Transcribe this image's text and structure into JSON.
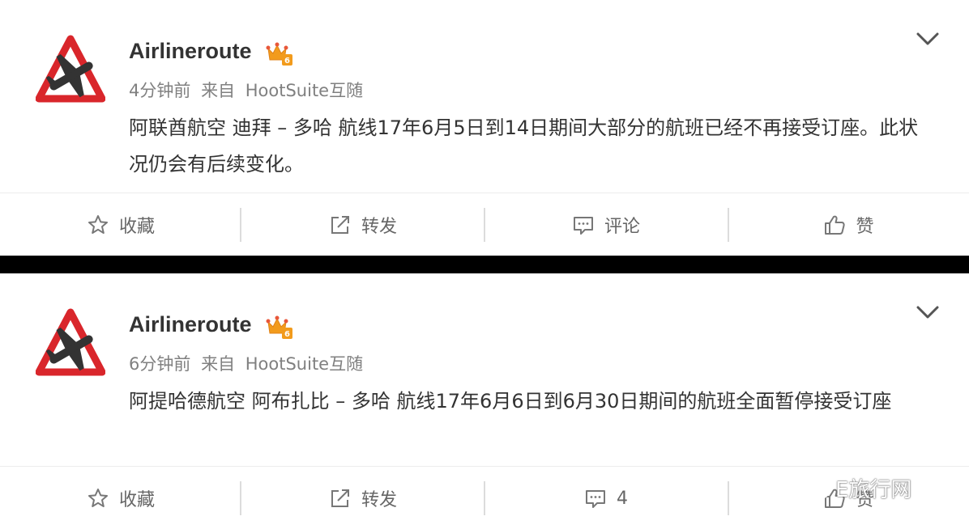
{
  "posts": [
    {
      "username": "Airlineroute",
      "time": "4分钟前",
      "source_prefix": "来自",
      "source": "HootSuite互随",
      "text": "阿联酋航空 迪拜 – 多哈 航线17年6月5日到14日期间大部分的航班已经不再接受订座。此状况仍会有后续变化。",
      "actions": {
        "favorite": "收藏",
        "repost": "转发",
        "comment": "评论",
        "like": "赞"
      }
    },
    {
      "username": "Airlineroute",
      "time": "6分钟前",
      "source_prefix": "来自",
      "source": "HootSuite互随",
      "text": "阿提哈德航空 阿布扎比 – 多哈 航线17年6月6日到6月30日期间的航班全面暂停接受订座",
      "actions": {
        "favorite": "收藏",
        "repost": "转发",
        "comment": "4",
        "like": "赞"
      }
    }
  ],
  "watermark": {
    "text": "E旅行网",
    "icon": "wechat-icon"
  },
  "colors": {
    "avatar_red": "#d9262b",
    "text_primary": "#333333",
    "text_meta": "#808080",
    "crown_orange": "#f29b1c"
  },
  "icons": {
    "favorite": "star-icon",
    "repost": "share-icon",
    "comment": "comment-icon",
    "like": "thumbs-up-icon",
    "menu": "chevron-down-icon",
    "badge": "crown-icon"
  }
}
